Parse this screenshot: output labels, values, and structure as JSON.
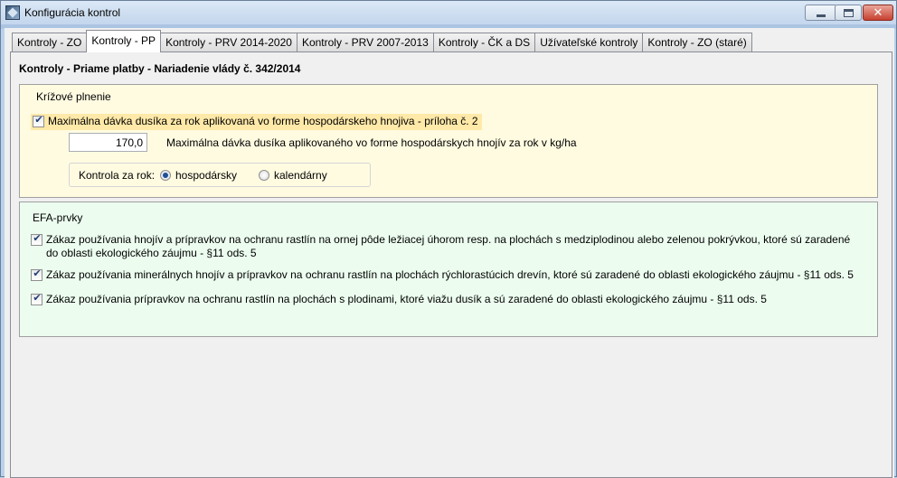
{
  "window": {
    "title": "Konfigurácia kontrol",
    "controls": {
      "minimize": "minimize-icon",
      "maximize": "maximize-icon",
      "close": "close-icon"
    }
  },
  "tabs": [
    {
      "label": "Kontroly - ZO",
      "active": false
    },
    {
      "label": "Kontroly - PP",
      "active": true
    },
    {
      "label": "Kontroly - PRV 2014-2020",
      "active": false
    },
    {
      "label": "Kontroly - PRV 2007-2013",
      "active": false
    },
    {
      "label": "Kontroly - ČK a DS",
      "active": false
    },
    {
      "label": "Užívateľské kontroly",
      "active": false
    },
    {
      "label": "Kontroly - ZO (staré)",
      "active": false
    }
  ],
  "page": {
    "heading": "Kontroly - Priame platby - Nariadenie vlády č. 342/2014"
  },
  "cross_compliance": {
    "title": "Krížové plnenie",
    "checkbox_label": "Maximálna dávka dusíka za rok aplikovaná vo forme hospodárskeho hnojiva - príloha č. 2",
    "checked": true,
    "value": "170,0",
    "value_description": "Maximálna dávka dusíka aplikovaného vo forme hospodárskych hnojív za rok v kg/ha",
    "radio_caption": "Kontrola za rok:",
    "radio_options": [
      {
        "label": "hospodársky",
        "selected": true
      },
      {
        "label": "kalendárny",
        "selected": false
      }
    ]
  },
  "efa": {
    "title": "EFA-prvky",
    "items": [
      {
        "label": "Zákaz používania hnojív a prípravkov na ochranu rastlín na ornej pôde ležiacej úhorom resp. na plochách s medziplodinou alebo zelenou pokrývkou, ktoré sú zaradené do oblasti ekologického záujmu - §11 ods. 5",
        "checked": true
      },
      {
        "label": "Zákaz používania minerálnych hnojív a prípravkov na ochranu rastlín na plochách rýchlorastúcich drevín, ktoré sú zaradené do oblasti ekologického záujmu - §11 ods. 5",
        "checked": true
      },
      {
        "label": "Zákaz používania prípravkov na ochranu rastlín na plochách s plodinami, ktoré viažu dusík a sú zaradené do oblasti ekologického záujmu - §11 ods. 5",
        "checked": true
      }
    ]
  },
  "colors": {
    "cross_bg": "#fffbe1",
    "efa_bg": "#ecfdef",
    "highlight": "#ffe9a8"
  }
}
